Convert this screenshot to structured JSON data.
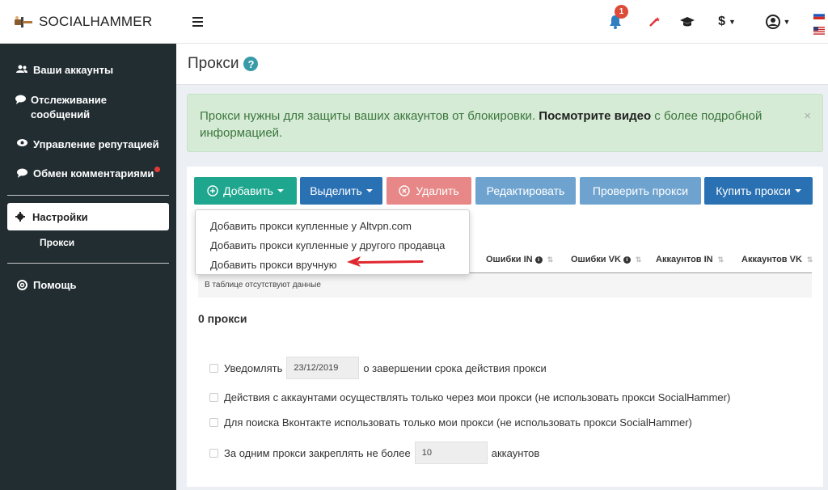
{
  "app": {
    "name": "SOCIALHAMMER"
  },
  "topbar": {
    "notification_count": "1",
    "currency_label": "$"
  },
  "sidebar": {
    "items": [
      {
        "label": "Ваши аккаунты"
      },
      {
        "label": "Отслеживание сообщений"
      },
      {
        "label": "Управление репутацией"
      },
      {
        "label": "Обмен комментариями"
      }
    ],
    "settings": {
      "label": "Настройки"
    },
    "sub_item": {
      "label": "Прокси"
    },
    "help": {
      "label": "Помощь"
    }
  },
  "page": {
    "title": "Прокси",
    "help_glyph": "?"
  },
  "alert": {
    "text": "Прокси нужны для защиты ваших аккаунтов от блокировки.",
    "link": "Посмотрите видео",
    "text_after": "с более подробной информацией.",
    "close": "×"
  },
  "toolbar": {
    "add": "Добавить",
    "select": "Выделить",
    "delete": "Удалить",
    "edit": "Редактировать",
    "check": "Проверить прокси",
    "buy": "Купить прокси"
  },
  "dropdown": {
    "items": [
      "Добавить прокси купленные у Altvpn.com",
      "Добавить прокси купленные у другого продавца",
      "Добавить прокси вручную"
    ]
  },
  "table": {
    "columns": [
      "Ошибки IN",
      "Ошибки VK",
      "Аккаунтов IN",
      "Аккаунтов VK"
    ],
    "empty": "В таблице отсутствуют данные"
  },
  "summary": {
    "count": "0 прокси"
  },
  "options": {
    "notify_before": "Уведомлять",
    "notify_date": "23/12/2019",
    "notify_after": "о завершении срока действия прокси",
    "own_only": "Действия с аккаунтами осуществлять только через мои прокси (не использовать прокси SocialHammer)",
    "vk_search": "Для поиска Вконтакте использовать только мои прокси (не использовать прокси SocialHammer)",
    "limit_before": "За одним прокси закреплять не более",
    "limit_value": "10",
    "limit_after": "аккаунтов"
  }
}
